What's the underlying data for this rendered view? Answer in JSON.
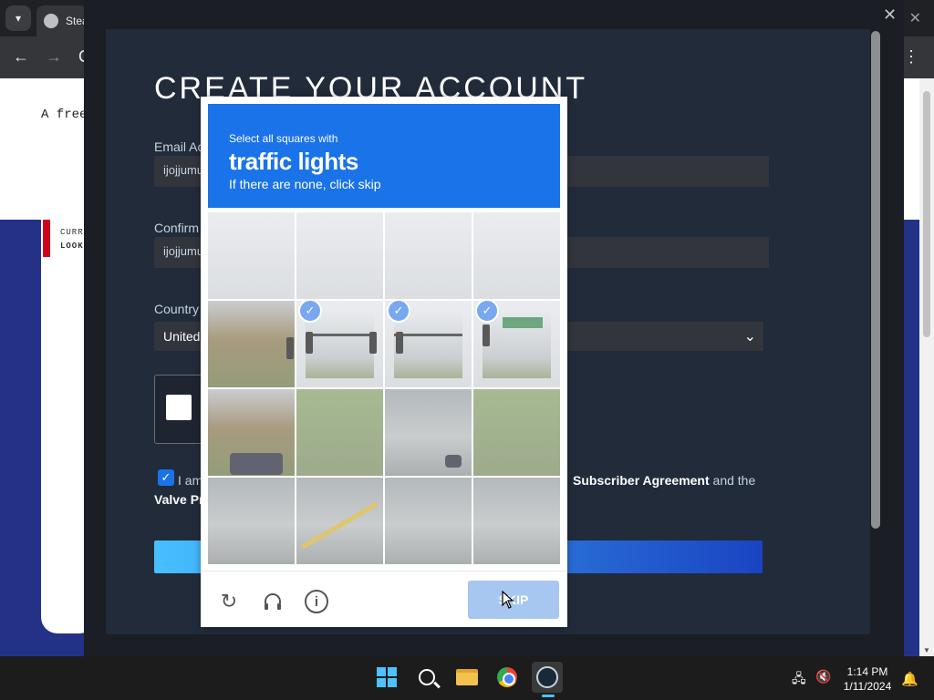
{
  "browser": {
    "tab_menu_icon": "chevron-down-icon",
    "tab_title": "Steam",
    "nav_back": "←",
    "nav_forward": "→",
    "nav_reload": "C",
    "menu": "⋮",
    "window_close": "✕"
  },
  "background_page": {
    "intro_text": "A free",
    "small_line1": "CURR",
    "small_line2": "LOOK"
  },
  "modal": {
    "close": "✕",
    "title": "CREATE YOUR ACCOUNT",
    "email_label": "Email Ac",
    "email_value": "ijojjumu",
    "confirm_label": "Confirm",
    "confirm_value": "ijojjumu",
    "country_label": "Country",
    "country_value": "United",
    "agree_prefix": "I am",
    "agree_link": "Subscriber Agreement",
    "agree_suffix": "and the",
    "agree_line2": "Valve Pr"
  },
  "captcha": {
    "instruction_small": "Select all squares with",
    "target": "traffic lights",
    "hint": "If there are none, click skip",
    "skip_label": "SKIP",
    "selected_tiles": [
      5,
      6,
      7
    ],
    "check_glyph": "✓",
    "refresh_icon": "↻",
    "audio_icon": "🎧",
    "info_icon": "i",
    "brand_color": "#1a73e8"
  },
  "taskbar": {
    "time": "1:14 PM",
    "date": "1/11/2024",
    "network_icon": "🖧",
    "volume_icon": "🔇",
    "bell_icon": "🔔"
  }
}
